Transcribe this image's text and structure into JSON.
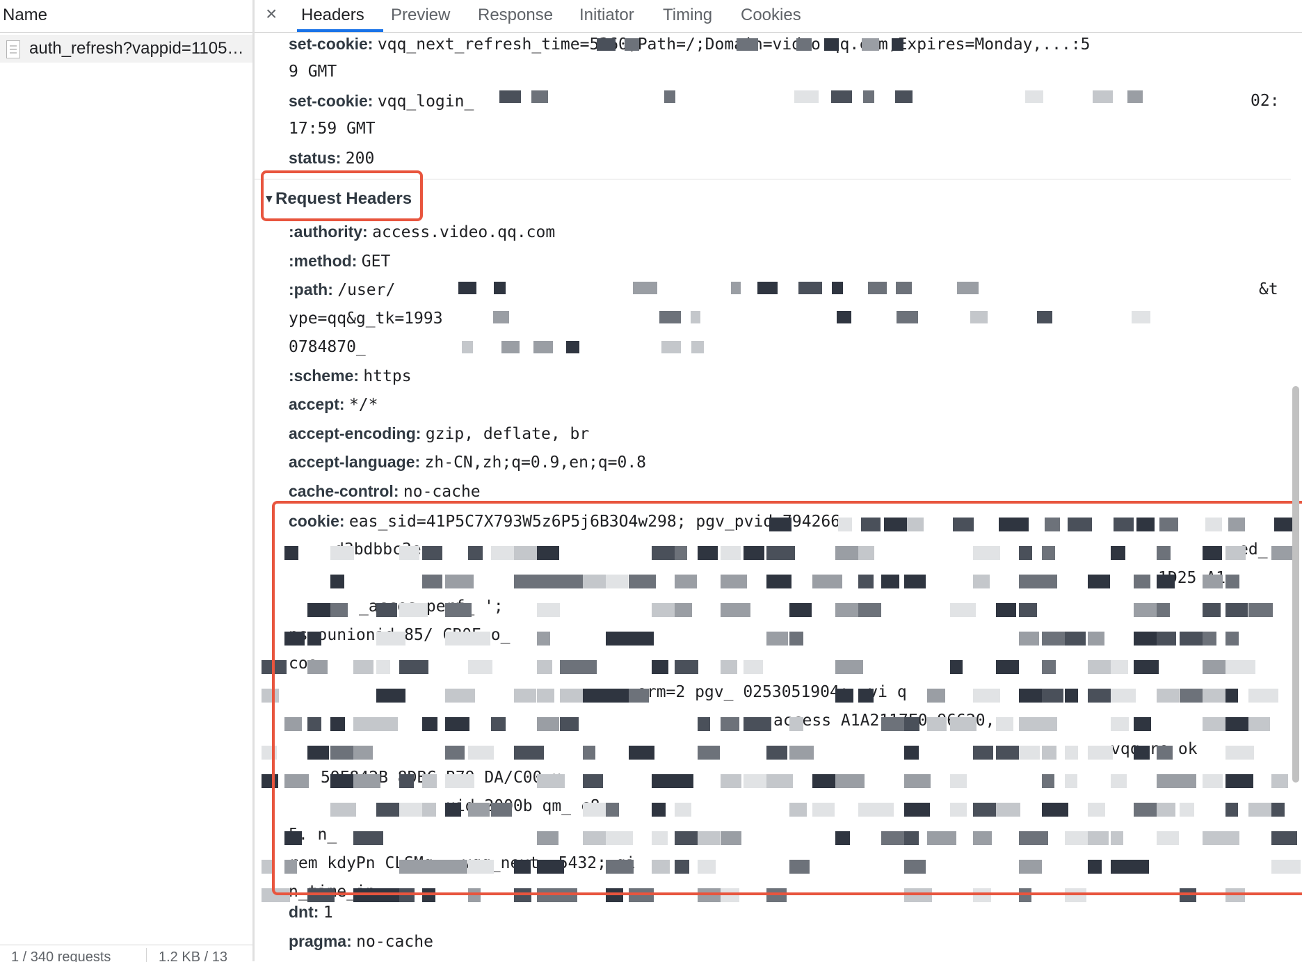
{
  "left_panel": {
    "column_header": "Name",
    "request_name": "auth_refresh?vappid=1105…",
    "footer_requests": "1 / 340 requests",
    "footer_size": "1.2 KB / 13"
  },
  "tabs": {
    "close": "×",
    "items": [
      "Headers",
      "Preview",
      "Response",
      "Initiator",
      "Timing",
      "Cookies"
    ],
    "active": "Headers"
  },
  "response_headers": [
    {
      "name": "set-cookie:",
      "value": "vqq_next_refresh_time=5360;Path=/;Domain=video.qq.com;Expires=Monday,...:5",
      "cont": "9 GMT"
    },
    {
      "name": "set-cookie:",
      "value": "vqq_login_",
      "value_end": "02:",
      "cont": "17:59 GMT"
    },
    {
      "name": "status:",
      "value": "200"
    }
  ],
  "request_headers_title": "Request Headers",
  "request_headers": {
    "authority": {
      "name": ":authority:",
      "value": "access.video.qq.com"
    },
    "method": {
      "name": ":method:",
      "value": "GET"
    },
    "path": {
      "name": ":path:",
      "value": "/user/",
      "value_end": "&t",
      "cont1": "ype=qq&g_tk=1993",
      "cont2": "0784870_"
    },
    "scheme": {
      "name": ":scheme:",
      "value": "https"
    },
    "accept": {
      "name": "accept:",
      "value": "*/*"
    },
    "accept_encoding": {
      "name": "accept-encoding:",
      "value": "gzip, deflate, br"
    },
    "accept_language": {
      "name": "accept-language:",
      "value": "zh-CN,zh;q=0.9,en;q=0.8"
    },
    "cache_control": {
      "name": "cache-control:",
      "value": "no-cache"
    },
    "cookie": {
      "name": "cookie:",
      "value": "eas_sid=41P5C7X793W5z6P5j6B3O4w298; pgv_pvid=794266",
      "lines": [
        "d3bdbbc3e",
        "ed_",
        "1D25   A1",
        "_acces    perf_    ';",
        "ps            ounionid   85/   CB0E    o_",
        "coo",
        "orm=2   pgv_   0253051904; _vi   q",
        "access   A1A2117E0   96620,",
        "vqq_re   ok",
        "59E842B   8DBC B79   DA/C00    u",
        "uid=2000b  qm_   c8",
        "5.   n_",
        "rem   kdyPn   CLSMq.. vqq_next_   5432;   gi",
        "n_time_in"
      ]
    },
    "dnt": {
      "name": "dnt:",
      "value": "1"
    },
    "pragma": {
      "name": "pragma:",
      "value": "no-cache"
    }
  },
  "colors": {
    "annotation": "#e8553e",
    "tab_underline": "#1a73e8",
    "selected_row": "#f2f2f2"
  }
}
